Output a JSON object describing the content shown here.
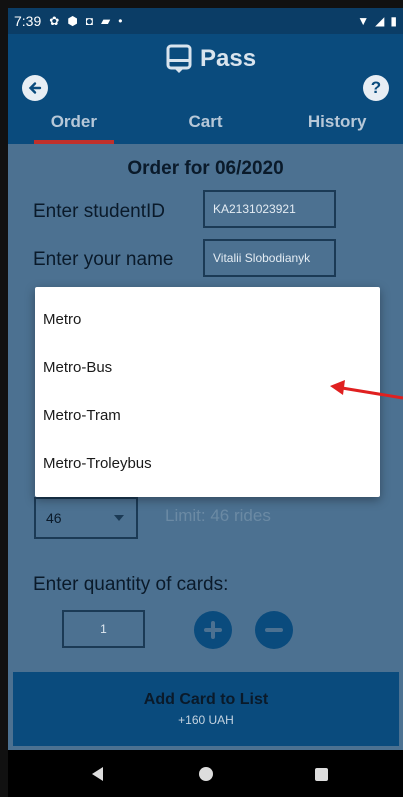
{
  "status": {
    "time": "7:39"
  },
  "header": {
    "title": "Pass",
    "help_label": "?"
  },
  "tabs": [
    {
      "label": "Order"
    },
    {
      "label": "Cart"
    },
    {
      "label": "History"
    }
  ],
  "order": {
    "title": "Order for 06/2020",
    "student_id_label": "Enter studentID",
    "student_id_value": "KA2131023921",
    "name_label": "Enter your name",
    "name_value": "Vitalii Slobodianyk",
    "rides_value": "46",
    "limit_text": "Limit: 46 rides",
    "quantity_label": "Enter quantity of cards:",
    "quantity_value": "1"
  },
  "dropdown": {
    "options": [
      "Metro",
      "Metro-Bus",
      "Metro-Tram",
      "Metro-Troleybus"
    ]
  },
  "add_button": {
    "title": "Add Card to List",
    "subtitle": "+160 UAH"
  },
  "colors": {
    "primary": "#0a4b7d",
    "background": "#4c7191",
    "tab_indicator": "#c0302b",
    "annotation_arrow": "#e02020"
  }
}
